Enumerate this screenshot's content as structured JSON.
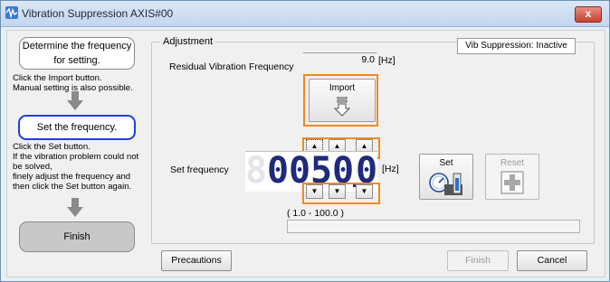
{
  "window": {
    "title": "Vibration Suppression AXIS#00",
    "close_label": "x"
  },
  "steps": {
    "step1": {
      "label_line1": "Determine the frequency",
      "label_line2": "for setting."
    },
    "desc1": {
      "line1": "Click the Import button.",
      "line2": "Manual setting is also possible."
    },
    "step2": {
      "label": "Set the frequency."
    },
    "desc2": {
      "line1": "Click the Set button.",
      "line2": "If the vibration problem could not",
      "line3": "be solved,",
      "line4": "finely adjust the frequency and",
      "line5": "then click the Set button again."
    },
    "step3": {
      "label": "Finish"
    }
  },
  "adjustment": {
    "group_label": "Adjustment",
    "status": "Vib Suppression: Inactive",
    "residual_label": "Residual Vibration Frequency",
    "residual_value": "9.0",
    "residual_unit": "[Hz]",
    "import_label": "Import",
    "set_freq_label": "Set frequency",
    "set_freq_digits": [
      "8",
      "0",
      "0",
      "5",
      "0",
      "0"
    ],
    "set_freq_unit": "[Hz]",
    "range_label": "(   1.0 -  100.0 )",
    "set_label": "Set",
    "reset_label": "Reset",
    "spin_up_glyph": "▲",
    "spin_down_glyph": "▼"
  },
  "footer": {
    "precautions": "Precautions",
    "finish": "Finish",
    "cancel": "Cancel"
  },
  "colors": {
    "highlight": "#ee8a22",
    "step_active": "#1f3fe0",
    "lcd": "#1f2a7a"
  }
}
